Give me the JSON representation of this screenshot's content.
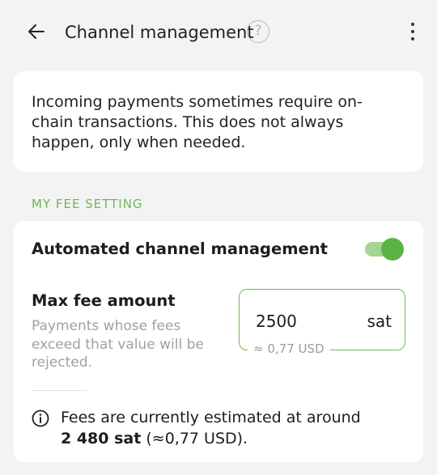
{
  "header": {
    "title": "Channel management",
    "help_glyph": "?",
    "icons": [
      "back-arrow-icon",
      "help-icon",
      "more-vertical-icon"
    ]
  },
  "info_card": {
    "text": "Incoming payments sometimes require on-chain transactions. This does not always happen, only when needed."
  },
  "fee_settings": {
    "section_label": "MY FEE SETTING",
    "auto_management_label": "Automated channel management",
    "auto_management_enabled": true,
    "max_fee": {
      "label": "Max fee amount",
      "description": "Payments whose fees exceed that value will be rejected.",
      "value": "2500",
      "unit": "sat",
      "fiat_estimate": "≈ 0,77 USD"
    },
    "estimate": {
      "prefix": "Fees are currently estimated at around",
      "amount": "2 480 sat",
      "suffix": "(≈0,77 USD).",
      "icon": "info-icon"
    }
  },
  "colors": {
    "accent": "#6cb950",
    "toggle_track": "#a6d494",
    "toggle_thumb": "#5bb343",
    "background": "#f3f3f3",
    "card": "#ffffff"
  }
}
